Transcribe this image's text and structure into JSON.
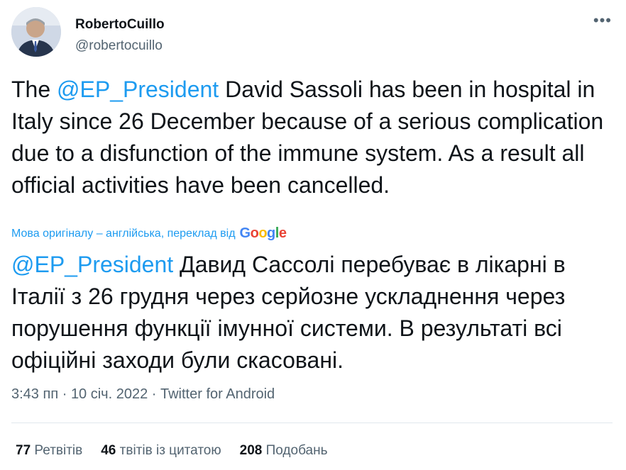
{
  "user": {
    "display_name": "RobertoCuillo",
    "handle": "@robertocuillo"
  },
  "tweet": {
    "mention": "@EP_President",
    "text_prefix": "The ",
    "text_rest": " David Sassoli has been in hospital in Italy since 26 December because of a serious complication due to a disfunction of the immune system. As a result all official activities have been cancelled."
  },
  "translation": {
    "note": "Мова оригіналу – англійська, переклад від",
    "provider": "Google",
    "mention": "@EP_President",
    "text_rest": " Давид Сассолі перебуває в лікарні в Італії з 26 грудня через серйозне ускладнення через порушення функції імунної системи. В результаті всі офіційні заходи були скасовані."
  },
  "meta": {
    "time": "3:43 пп",
    "separator": " · ",
    "date": "10 січ. 2022",
    "source": "Twitter for Android"
  },
  "stats": {
    "retweets_count": "77",
    "retweets_label": "Ретвітів",
    "quotes_count": "46",
    "quotes_label": "твітів із цитатою",
    "likes_count": "208",
    "likes_label": "Подобань"
  },
  "icons": {
    "more": "more-dots-icon"
  },
  "colors": {
    "link": "#1d9bf0",
    "secondary_text": "#536471",
    "divider": "#e1e8ed"
  }
}
